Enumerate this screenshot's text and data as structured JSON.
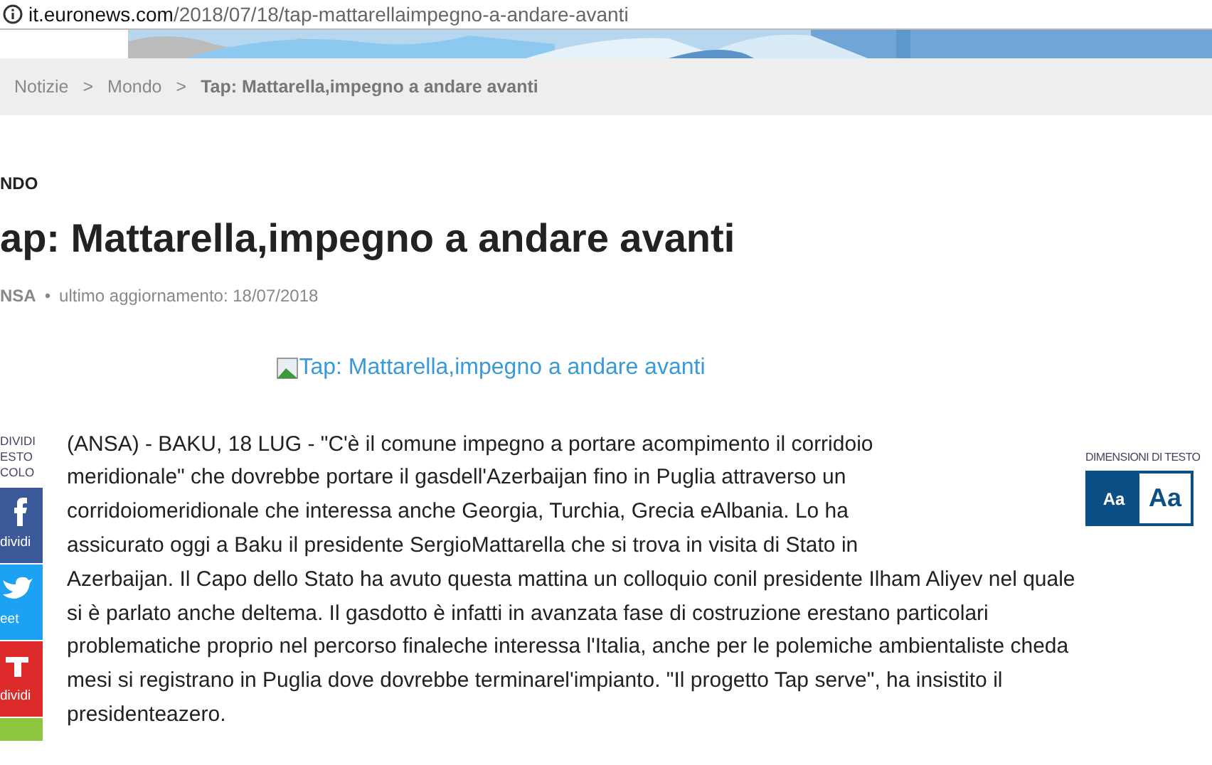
{
  "address_bar": {
    "domain": "it.euronews.com",
    "path": "/2018/07/18/tap-mattarellaimpegno-a-andare-avanti"
  },
  "breadcrumb": [
    "Notizie",
    "Mondo",
    "Tap: Mattarella,impegno a andare avanti"
  ],
  "breadcrumb_separator": ">",
  "meta_separator": "•",
  "section": "NDO",
  "headline": "ap: Mattarella,impegno a andare avanti",
  "source": "NSA",
  "updated": "ultimo aggiornamento: 18/07/2018",
  "image_alt": "Tap: Mattarella,impegno a andare avanti",
  "share": {
    "label": [
      "DIVIDI",
      "ESTO",
      "COLO"
    ],
    "buttons": [
      {
        "kind": "facebook",
        "label": "dividi"
      },
      {
        "kind": "twitter",
        "label": "eet"
      },
      {
        "kind": "google",
        "label": "dividi"
      },
      {
        "kind": "more"
      }
    ]
  },
  "text_size": {
    "label": "DIMENSIONI DI TESTO",
    "options": [
      {
        "label": "Aa",
        "selected": true
      },
      {
        "label": "Aa",
        "selected": false
      }
    ]
  },
  "body_lines": [
    "(ANSA) - BAKU, 18 LUG - \"C'è il comune impegno a portare acompimento il corridoio",
    "meridionale\" che dovrebbe portare il gasdell'Azerbaijan fino in Puglia attraverso un",
    "corridoiomeridionale che interessa anche Georgia, Turchia, Grecia eAlbania. Lo ha",
    "assicurato oggi a Baku il presidente SergioMattarella che si trova in visita di Stato in",
    "Azerbaijan. Il Capo dello Stato ha avuto questa mattina un colloquio conil presidente Ilham Aliyev nel quale",
    "si è parlato anche deltema. Il gasdotto è infatti in avanzata fase di costruzione erestano particolari",
    "problematiche proprio nel percorso finaleche interessa l'Italia, anche per le polemiche ambientaliste cheda",
    "mesi si registrano in Puglia dove dovrebbe terminarel'impianto. \"Il progetto Tap serve\", ha insistito il",
    "presidenteazero."
  ]
}
